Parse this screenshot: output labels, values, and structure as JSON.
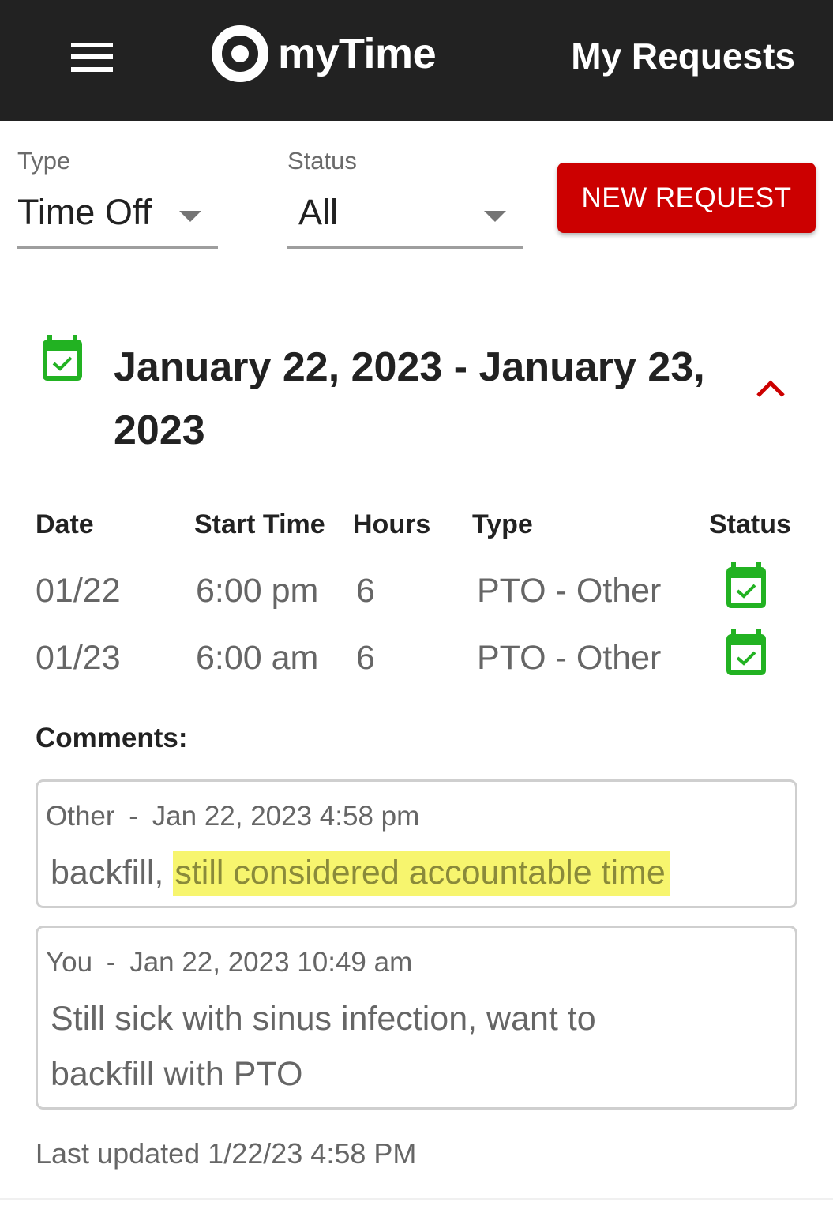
{
  "header": {
    "menu_icon": "hamburger-menu-icon",
    "logo_icon": "bullseye-logo-icon",
    "app_name": "myTime",
    "page_title": "My Requests"
  },
  "filters": {
    "type": {
      "label": "Type",
      "value": "Time Off"
    },
    "status": {
      "label": "Status",
      "value": "All"
    },
    "new_request_label": "NEW REQUEST"
  },
  "request": {
    "status_icon": "calendar-check-icon",
    "title": "January 22, 2023 - January 23, 2023",
    "collapse_icon": "chevron-up-icon",
    "columns": [
      "Date",
      "Start Time",
      "Hours",
      "Type",
      "Status"
    ],
    "rows": [
      {
        "date": "01/22",
        "start_time": "6:00 pm",
        "hours": "6",
        "type": "PTO - Other",
        "status": "approved"
      },
      {
        "date": "01/23",
        "start_time": "6:00 am",
        "hours": "6",
        "type": "PTO - Other",
        "status": "approved"
      }
    ],
    "comments_label": "Comments:",
    "comments": [
      {
        "author": "Other",
        "separator": "-",
        "timestamp": "Jan 22, 2023 4:58 pm",
        "text_plain": "backfill, ",
        "text_highlighted": "still considered accountable time"
      },
      {
        "author": "You",
        "separator": "-",
        "timestamp": "Jan 22, 2023 10:49 am",
        "text": "Still sick with sinus infection, want to backfill with PTO"
      }
    ],
    "last_updated": "Last updated 1/22/23 4:58 PM"
  },
  "colors": {
    "header_bg": "#222222",
    "accent_red": "#cc0000",
    "approved_green": "#22b222",
    "highlight_yellow": "#f7f56e"
  }
}
